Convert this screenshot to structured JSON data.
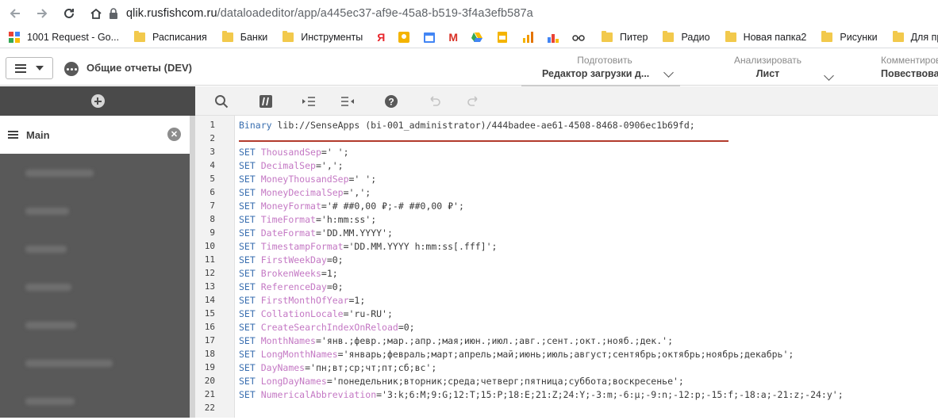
{
  "browser": {
    "url_host": "qlik.rusfishcom.ru",
    "url_path": "/dataloadeditor/app/a445ec37-af9e-45a8-b519-3f4a3efb587a",
    "bookmarks": [
      {
        "label": "1001 Request - Go...",
        "icon": "apps-grid-icon"
      },
      {
        "label": "Расписания",
        "icon": "folder-icon"
      },
      {
        "label": "Банки",
        "icon": "folder-icon"
      },
      {
        "label": "Инструменты",
        "icon": "folder-icon"
      },
      {
        "label": "Питер",
        "icon": "folder-icon"
      },
      {
        "label": "Радио",
        "icon": "folder-icon"
      },
      {
        "label": "Новая папка2",
        "icon": "folder-icon"
      },
      {
        "label": "Рисунки",
        "icon": "folder-icon"
      },
      {
        "label": "Для проекто",
        "icon": "folder-icon"
      }
    ]
  },
  "app": {
    "title": "Общие отчеты (DEV)",
    "modes": [
      {
        "sub": "Подготовить",
        "main": "Редактор загрузки д..."
      },
      {
        "sub": "Анализировать",
        "main": "Лист"
      },
      {
        "sub": "Комментиров",
        "main": "Повествова"
      }
    ]
  },
  "sections": {
    "active": "Main"
  },
  "editor": {
    "line_numbers": [
      "1",
      "2",
      "3",
      "4",
      "5",
      "6",
      "7",
      "8",
      "9",
      "10",
      "11",
      "12",
      "13",
      "14",
      "15",
      "16",
      "17",
      "18",
      "19",
      "20",
      "21",
      "22"
    ],
    "lines": [
      {
        "kw": "Binary",
        "var": "",
        "rest": " lib://SenseApps (bi-001_administrator)/444badee-ae61-4508-8468-0906ec1b69fd;"
      },
      {
        "kw": "",
        "var": "",
        "rest": ""
      },
      {
        "kw": "SET",
        "var": "ThousandSep",
        "rest": "=' ';"
      },
      {
        "kw": "SET",
        "var": "DecimalSep",
        "rest": "=',';"
      },
      {
        "kw": "SET",
        "var": "MoneyThousandSep",
        "rest": "=' ';"
      },
      {
        "kw": "SET",
        "var": "MoneyDecimalSep",
        "rest": "=',';"
      },
      {
        "kw": "SET",
        "var": "MoneyFormat",
        "rest": "='# ##0,00 ₽;-# ##0,00 ₽';"
      },
      {
        "kw": "SET",
        "var": "TimeFormat",
        "rest": "='h:mm:ss';"
      },
      {
        "kw": "SET",
        "var": "DateFormat",
        "rest": "='DD.MM.YYYY';"
      },
      {
        "kw": "SET",
        "var": "TimestampFormat",
        "rest": "='DD.MM.YYYY h:mm:ss[.fff]';"
      },
      {
        "kw": "SET",
        "var": "FirstWeekDay",
        "rest": "=0;"
      },
      {
        "kw": "SET",
        "var": "BrokenWeeks",
        "rest": "=1;"
      },
      {
        "kw": "SET",
        "var": "ReferenceDay",
        "rest": "=0;"
      },
      {
        "kw": "SET",
        "var": "FirstMonthOfYear",
        "rest": "=1;"
      },
      {
        "kw": "SET",
        "var": "CollationLocale",
        "rest": "='ru-RU';"
      },
      {
        "kw": "SET",
        "var": "CreateSearchIndexOnReload",
        "rest": "=0;"
      },
      {
        "kw": "SET",
        "var": "MonthNames",
        "rest": "='янв.;февр.;мар.;апр.;мая;июн.;июл.;авг.;сент.;окт.;нояб.;дек.';"
      },
      {
        "kw": "SET",
        "var": "LongMonthNames",
        "rest": "='январь;февраль;март;апрель;май;июнь;июль;август;сентябрь;октябрь;ноябрь;декабрь';"
      },
      {
        "kw": "SET",
        "var": "DayNames",
        "rest": "='пн;вт;ср;чт;пт;сб;вс';"
      },
      {
        "kw": "SET",
        "var": "LongDayNames",
        "rest": "='понедельник;вторник;среда;четверг;пятница;суббота;воскресенье';"
      },
      {
        "kw": "SET",
        "var": "NumericalAbbreviation",
        "rest": "='3:k;6:M;9:G;12:T;15:P;18:E;21:Z;24:Y;-3:m;-6:μ;-9:n;-12:p;-15:f;-18:a;-21:z;-24:y';"
      },
      {
        "kw": "",
        "var": "",
        "rest": ""
      }
    ]
  },
  "colors": {
    "keyword": "#3a6fb0",
    "variable": "#c478c4",
    "error_underline": "#b23a2c",
    "sidebar_bg": "#595959"
  }
}
